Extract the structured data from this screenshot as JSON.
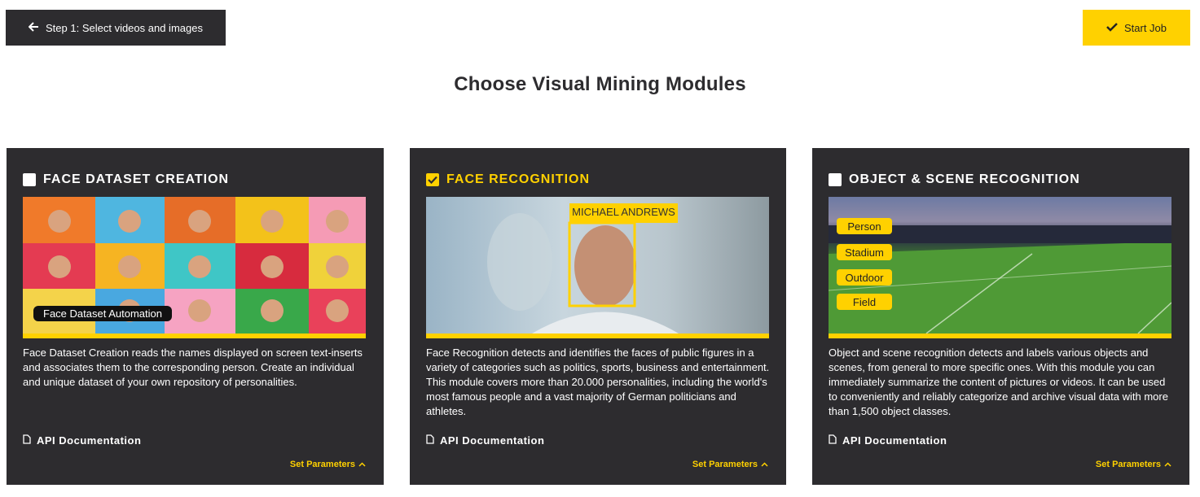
{
  "header": {
    "back_label": "Step 1: Select videos and images",
    "start_label": "Start Job",
    "title": "Choose Visual Mining Modules"
  },
  "modules": [
    {
      "title": "FACE DATASET CREATION",
      "checked": false,
      "image_caption": "Face Dataset Automation",
      "description": "Face Dataset Creation reads the names displayed on screen text-inserts and associates them to the corresponding person. Create an individual and unique dataset of your own repository of personalities.",
      "api_label": "API Documentation",
      "params_label": "Set Parameters"
    },
    {
      "title": "FACE RECOGNITION",
      "checked": true,
      "image_caption": "MICHAEL ANDREWS",
      "description": "Face Recognition detects and identifies the faces of public figures in a variety of categories such as politics, sports, business and entertainment. This module covers more than 20.000 personalities, including the world's most famous people and a vast majority of German politicians and athletes.",
      "api_label": "API Documentation",
      "params_label": "Set Parameters"
    },
    {
      "title": "OBJECT & SCENE RECOGNITION",
      "checked": false,
      "tags": [
        "Person",
        "Stadium",
        "Outdoor",
        "Field"
      ],
      "description": "Object and scene recognition detects and labels various objects and scenes, from general to more specific ones. With this module you can immediately summarize the content of pictures or videos. It can be used to conveniently and reliably categorize and archive visual data with more than 1,500 object classes.",
      "api_label": "API Documentation",
      "params_label": "Set Parameters"
    }
  ],
  "colors": {
    "accent": "#ffd100",
    "card_bg": "#2d2c2f",
    "page_bg": "#ffffff"
  },
  "icons": {
    "back": "arrow-left-icon",
    "start": "check-icon",
    "api": "file-icon",
    "params": "chevron-up-icon"
  }
}
